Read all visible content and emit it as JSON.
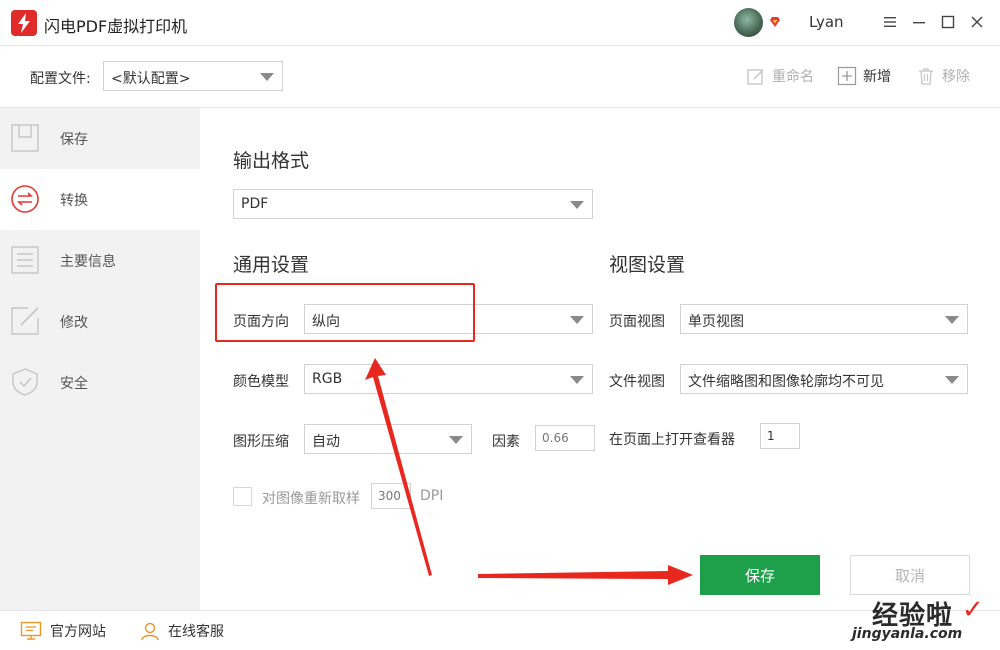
{
  "app": {
    "title": "闪电PDF虚拟打印机"
  },
  "user": {
    "name": "Lyan"
  },
  "config": {
    "label": "配置文件:",
    "selected": "<默认配置>",
    "actions": {
      "rename": "重命名",
      "add": "新增",
      "remove": "移除"
    }
  },
  "sidebar": {
    "items": [
      {
        "label": "保存",
        "icon": "save-icon"
      },
      {
        "label": "转换",
        "icon": "convert-icon"
      },
      {
        "label": "主要信息",
        "icon": "list-icon"
      },
      {
        "label": "修改",
        "icon": "edit-icon"
      },
      {
        "label": "安全",
        "icon": "shield-icon"
      }
    ]
  },
  "main": {
    "output_format": {
      "title": "输出格式",
      "value": "PDF"
    },
    "general": {
      "title": "通用设置",
      "page_orientation": {
        "label": "页面方向",
        "value": "纵向"
      },
      "color_model": {
        "label": "颜色模型",
        "value": "RGB"
      },
      "compression": {
        "label": "图形压缩",
        "value": "自动"
      },
      "factor": {
        "label": "因素",
        "value": "0.66"
      },
      "resample": {
        "label": "对图像重新取样",
        "value": "300",
        "unit": "DPI"
      }
    },
    "view": {
      "title": "视图设置",
      "page_view": {
        "label": "页面视图",
        "value": "单页视图"
      },
      "document_view": {
        "label": "文件视图",
        "value": "文件缩略图和图像轮廓均不可见"
      },
      "open_viewer": {
        "label": "在页面上打开查看器",
        "value": "1"
      }
    },
    "buttons": {
      "save": "保存",
      "cancel": "取消"
    }
  },
  "footer": {
    "website": "官方网站",
    "support": "在线客服"
  },
  "watermark": {
    "main": "经验啦",
    "sub": "jingyanla.com",
    "check": "✓"
  },
  "colors": {
    "accent_green": "#1ea04a",
    "annotation_red": "#e8271f",
    "logo_red": "#e02b2b"
  }
}
